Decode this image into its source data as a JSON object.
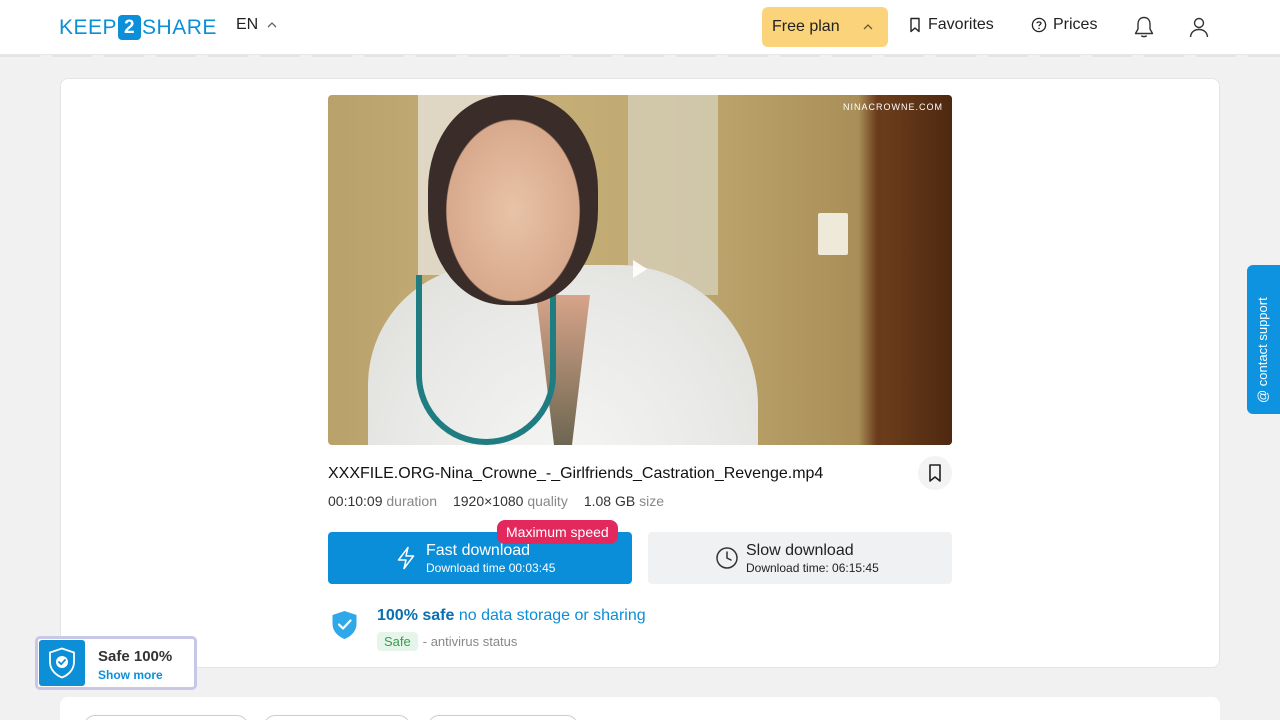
{
  "header": {
    "logo_left": "KEEP",
    "logo_mid": "2",
    "logo_right": "SHARE",
    "language": "EN",
    "plan_label": "Free plan",
    "favorites_label": "Favorites",
    "prices_label": "Prices"
  },
  "video": {
    "watermark": "NINACROWNE.COM"
  },
  "file": {
    "name": "XXXFILE.ORG-Nina_Crowne_-_Girlfriends_Castration_Revenge.mp4",
    "duration": "00:10:09",
    "duration_label": "duration",
    "quality": "1920×1080",
    "quality_label": "quality",
    "size": "1.08 GB",
    "size_label": "size"
  },
  "download": {
    "fast_label": "Fast download",
    "fast_time": "Download time 00:03:45",
    "badge": "Maximum speed",
    "slow_label": "Slow download",
    "slow_time": "Download time: 06:15:45"
  },
  "safety": {
    "headline_bold": "100% safe",
    "headline_rest": "no data storage or sharing",
    "tag": "Safe",
    "tag_desc": "- antivirus status"
  },
  "support": {
    "label": "@ contact support"
  },
  "safe_popup": {
    "title": "Safe 100%",
    "link": "Show more"
  },
  "colors": {
    "brand_blue": "#0a8ed9",
    "plan_yellow": "#fbd37a",
    "badge_red": "#e2285d"
  }
}
